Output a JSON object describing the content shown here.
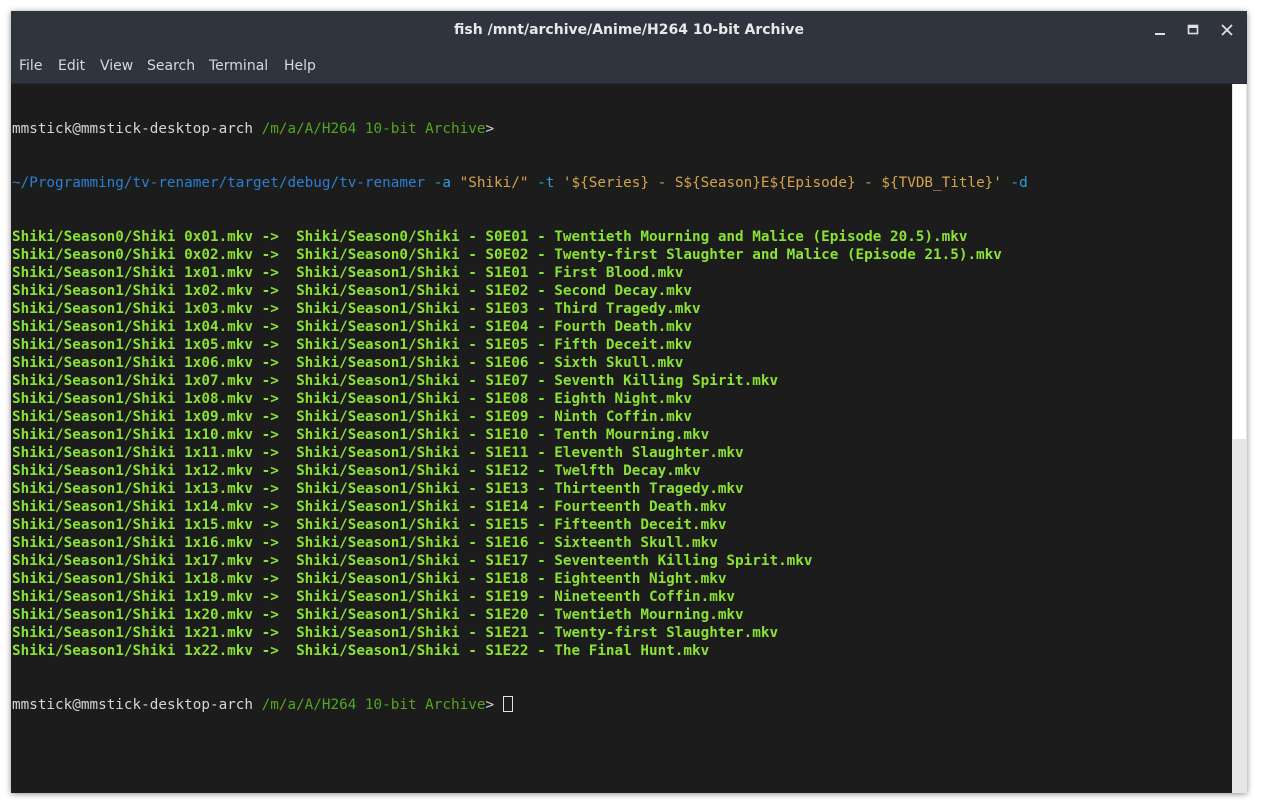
{
  "window": {
    "title": "fish  /mnt/archive/Anime/H264 10-bit Archive"
  },
  "titlebar_buttons": [
    {
      "name": "minimize-icon"
    },
    {
      "name": "maximize-icon"
    },
    {
      "name": "close-icon"
    }
  ],
  "menu": {
    "items": [
      {
        "label": "File"
      },
      {
        "label": "Edit"
      },
      {
        "label": "View"
      },
      {
        "label": "Search"
      },
      {
        "label": "Terminal"
      },
      {
        "label": "Help"
      }
    ]
  },
  "colors": {
    "terminal_bg": "#1c1c1c",
    "chrome_bg": "#2f343f",
    "output_green": "#8ae234",
    "prompt_path": "#55a51e",
    "command_blue": "#2d7fd2",
    "string_yellow": "#d4a44a"
  },
  "terminal": {
    "prompt": {
      "user": "mmstick",
      "at": "@",
      "host": "mmstick-desktop-arch",
      "cwd": "/m/a/A/H264 10-bit Archive",
      "symbol": ">"
    },
    "command": {
      "program": "~/Programming/tv-renamer/target/debug/tv-renamer",
      "flag_a": "-a",
      "arg_a": "\"Shiki/\"",
      "flag_t": "-t",
      "arg_t": "'${Series} - S${Season}E${Episode} - ${TVDB_Title}'",
      "flag_d": "-d"
    },
    "output": [
      {
        "src": "Shiki/Season0/Shiki 0x01.mkv",
        "dst": "Shiki/Season0/Shiki - S0E01 - Twentieth Mourning and Malice (Episode 20.5).mkv"
      },
      {
        "src": "Shiki/Season0/Shiki 0x02.mkv",
        "dst": "Shiki/Season0/Shiki - S0E02 - Twenty-first Slaughter and Malice (Episode 21.5).mkv"
      },
      {
        "src": "Shiki/Season1/Shiki 1x01.mkv",
        "dst": "Shiki/Season1/Shiki - S1E01 - First Blood.mkv"
      },
      {
        "src": "Shiki/Season1/Shiki 1x02.mkv",
        "dst": "Shiki/Season1/Shiki - S1E02 - Second Decay.mkv"
      },
      {
        "src": "Shiki/Season1/Shiki 1x03.mkv",
        "dst": "Shiki/Season1/Shiki - S1E03 - Third Tragedy.mkv"
      },
      {
        "src": "Shiki/Season1/Shiki 1x04.mkv",
        "dst": "Shiki/Season1/Shiki - S1E04 - Fourth Death.mkv"
      },
      {
        "src": "Shiki/Season1/Shiki 1x05.mkv",
        "dst": "Shiki/Season1/Shiki - S1E05 - Fifth Deceit.mkv"
      },
      {
        "src": "Shiki/Season1/Shiki 1x06.mkv",
        "dst": "Shiki/Season1/Shiki - S1E06 - Sixth Skull.mkv"
      },
      {
        "src": "Shiki/Season1/Shiki 1x07.mkv",
        "dst": "Shiki/Season1/Shiki - S1E07 - Seventh Killing Spirit.mkv"
      },
      {
        "src": "Shiki/Season1/Shiki 1x08.mkv",
        "dst": "Shiki/Season1/Shiki - S1E08 - Eighth Night.mkv"
      },
      {
        "src": "Shiki/Season1/Shiki 1x09.mkv",
        "dst": "Shiki/Season1/Shiki - S1E09 - Ninth Coffin.mkv"
      },
      {
        "src": "Shiki/Season1/Shiki 1x10.mkv",
        "dst": "Shiki/Season1/Shiki - S1E10 - Tenth Mourning.mkv"
      },
      {
        "src": "Shiki/Season1/Shiki 1x11.mkv",
        "dst": "Shiki/Season1/Shiki - S1E11 - Eleventh Slaughter.mkv"
      },
      {
        "src": "Shiki/Season1/Shiki 1x12.mkv",
        "dst": "Shiki/Season1/Shiki - S1E12 - Twelfth Decay.mkv"
      },
      {
        "src": "Shiki/Season1/Shiki 1x13.mkv",
        "dst": "Shiki/Season1/Shiki - S1E13 - Thirteenth Tragedy.mkv"
      },
      {
        "src": "Shiki/Season1/Shiki 1x14.mkv",
        "dst": "Shiki/Season1/Shiki - S1E14 - Fourteenth Death.mkv"
      },
      {
        "src": "Shiki/Season1/Shiki 1x15.mkv",
        "dst": "Shiki/Season1/Shiki - S1E15 - Fifteenth Deceit.mkv"
      },
      {
        "src": "Shiki/Season1/Shiki 1x16.mkv",
        "dst": "Shiki/Season1/Shiki - S1E16 - Sixteenth Skull.mkv"
      },
      {
        "src": "Shiki/Season1/Shiki 1x17.mkv",
        "dst": "Shiki/Season1/Shiki - S1E17 - Seventeenth Killing Spirit.mkv"
      },
      {
        "src": "Shiki/Season1/Shiki 1x18.mkv",
        "dst": "Shiki/Season1/Shiki - S1E18 - Eighteenth Night.mkv"
      },
      {
        "src": "Shiki/Season1/Shiki 1x19.mkv",
        "dst": "Shiki/Season1/Shiki - S1E19 - Nineteenth Coffin.mkv"
      },
      {
        "src": "Shiki/Season1/Shiki 1x20.mkv",
        "dst": "Shiki/Season1/Shiki - S1E20 - Twentieth Mourning.mkv"
      },
      {
        "src": "Shiki/Season1/Shiki 1x21.mkv",
        "dst": "Shiki/Season1/Shiki - S1E21 - Twenty-first Slaughter.mkv"
      },
      {
        "src": "Shiki/Season1/Shiki 1x22.mkv",
        "dst": "Shiki/Season1/Shiki - S1E22 - The Final Hunt.mkv"
      }
    ],
    "arrow": "->",
    "scroll_fraction_visible": 0.5
  }
}
